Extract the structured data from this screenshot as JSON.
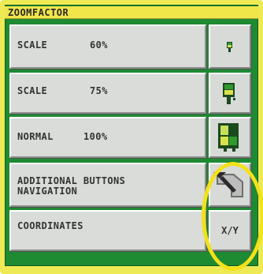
{
  "panel": {
    "title": "ZOOMFACTOR"
  },
  "rows": [
    {
      "name": "SCALE",
      "value": "60%",
      "icon": "small-square-icon"
    },
    {
      "name": "SCALE",
      "value": "75%",
      "icon": "medium-square-icon"
    },
    {
      "name": "NORMAL",
      "value": "100%",
      "icon": "large-square-icon"
    }
  ],
  "additional": {
    "line1": "ADDITIONAL BUTTONS",
    "line2": "NAVIGATION",
    "icon": "navigation-arrow-icon"
  },
  "coordinates": {
    "label": "COORDINATES",
    "button": "X/Y"
  },
  "colors": {
    "bezel": "#eeea55",
    "screen": "#1e8a32",
    "button": "#d9dcd9",
    "highlight": "#f3e11a",
    "icon_green": "#2f9a2f",
    "icon_yellow": "#d9e24b"
  }
}
